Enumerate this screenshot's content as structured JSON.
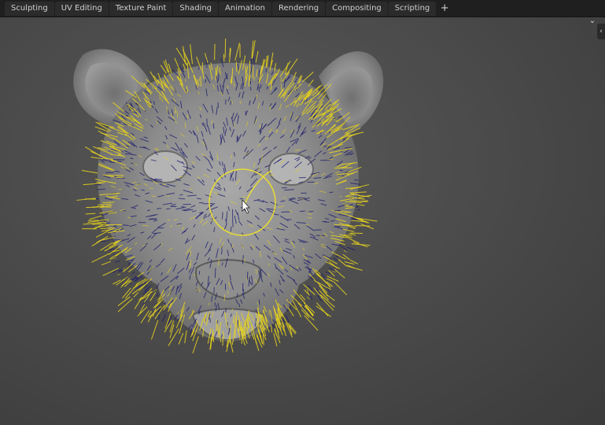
{
  "workspace_tabs": [
    {
      "label": "Sculpting"
    },
    {
      "label": "UV Editing"
    },
    {
      "label": "Texture Paint"
    },
    {
      "label": "Shading"
    },
    {
      "label": "Animation"
    },
    {
      "label": "Rendering"
    },
    {
      "label": "Compositing"
    },
    {
      "label": "Scripting"
    }
  ],
  "add_tab_glyph": "+",
  "viewport": {
    "header_toggle_glyph": "⌄",
    "sidebar_toggle_glyph": "‹",
    "model": "lion-head-sculpt",
    "hair_guide_color": "#e6d21e",
    "hair_strand_color": "#1a1a6e",
    "brush_cursor_color": "#e8dc32"
  }
}
